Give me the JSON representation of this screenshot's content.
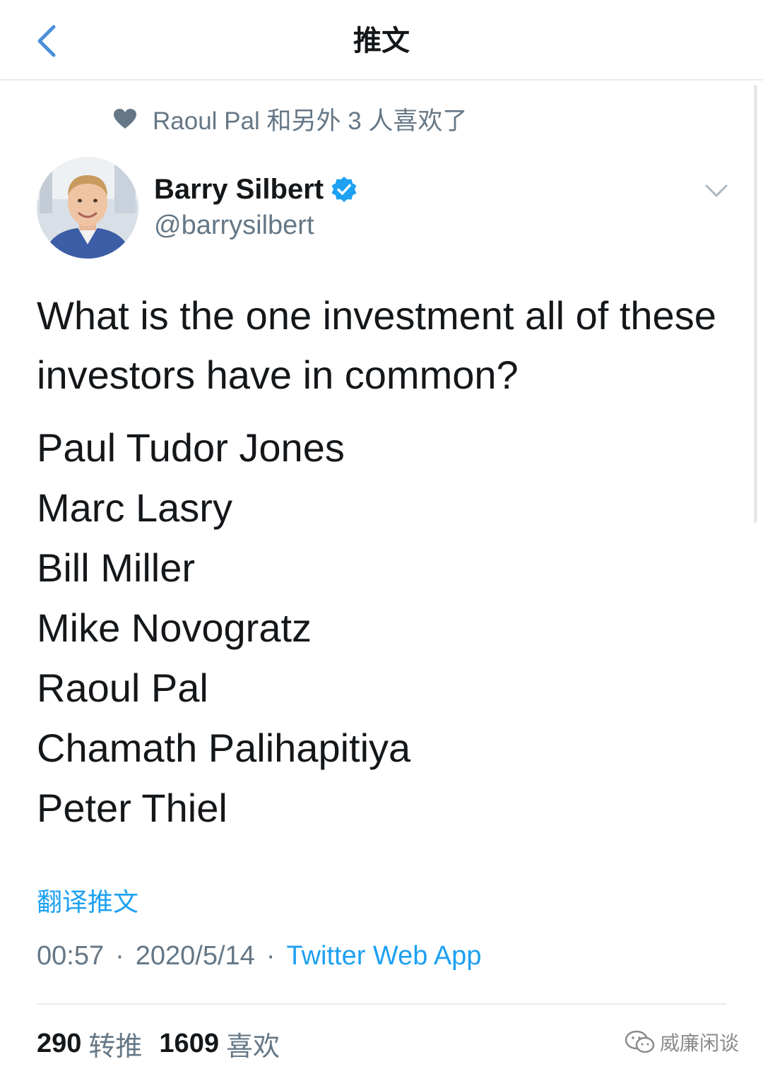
{
  "header": {
    "title": "推文",
    "back_icon": "chevron-left-icon"
  },
  "social_context": {
    "icon": "heart-icon",
    "text": "Raoul Pal 和另外 3 人喜欢了"
  },
  "author": {
    "display_name": "Barry Silbert",
    "handle": "@barrysilbert",
    "verified": true
  },
  "tweet": {
    "question": "What is the one investment all of these investors have in common?",
    "investors": [
      "Paul Tudor Jones",
      "Marc Lasry",
      "Bill Miller",
      "Mike Novogratz",
      "Raoul Pal",
      "Chamath Palihapitiya",
      "Peter Thiel"
    ],
    "translate_label": "翻译推文"
  },
  "meta": {
    "time": "00:57",
    "date": "2020/5/14",
    "separator": "·",
    "source": "Twitter Web App"
  },
  "stats": {
    "retweets_count": "290",
    "retweets_label": "转推",
    "likes_count": "1609",
    "likes_label": "喜欢"
  },
  "watermark": {
    "text": "威廉闲谈"
  },
  "colors": {
    "accent": "#1da1f2",
    "text_primary": "#14171a",
    "text_secondary": "#657786",
    "divider": "#e6ecf0",
    "back_icon": "#4a90d9"
  }
}
